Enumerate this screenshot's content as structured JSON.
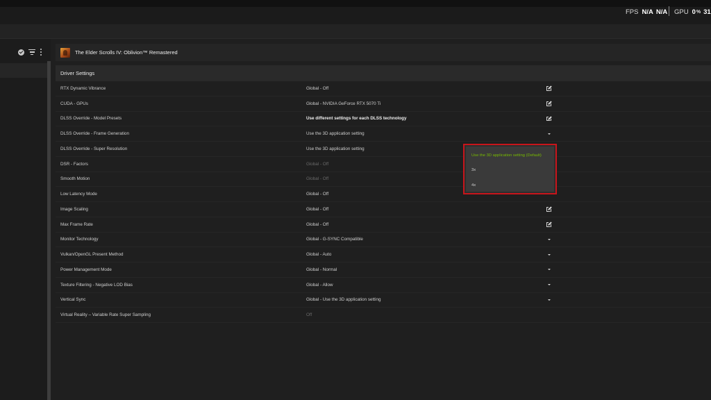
{
  "overlay": {
    "fps_label": "FPS",
    "fps_value1": "N/A",
    "fps_value2": "N/A",
    "gpu_label": "GPU",
    "gpu_value": "0",
    "gpu_unit": "%",
    "gpu_partial": "31"
  },
  "sidebar": {
    "icons": [
      "check-circle-icon",
      "filter-icon",
      "more-vertical-icon"
    ]
  },
  "game": {
    "title": "The Elder Scrolls IV: Oblivion™ Remastered"
  },
  "section": {
    "title": "Driver Settings"
  },
  "settings": [
    {
      "name": "RTX Dynamic Vibrance",
      "value": "Global - Off",
      "action": "edit"
    },
    {
      "name": "CUDA - GPUs",
      "value": "Global - NVIDIA GeForce RTX 5070 Ti",
      "action": "edit"
    },
    {
      "name": "DLSS Override - Model Presets",
      "value": "Use different settings for each DLSS technology",
      "action": "edit",
      "bold": true
    },
    {
      "name": "DLSS Override - Frame Generation",
      "value": "Use the 3D application setting",
      "action": "dropdown"
    },
    {
      "name": "DLSS Override - Super Resolution",
      "value": "Use the 3D application setting",
      "action": "none"
    },
    {
      "name": "DSR - Factors",
      "value": "Global - Off",
      "action": "none",
      "dim": true
    },
    {
      "name": "Smooth Motion",
      "value": "Global - Off",
      "action": "none",
      "dim": true
    },
    {
      "name": "Low Latency Mode",
      "value": "Global - Off",
      "action": "none"
    },
    {
      "name": "Image Scaling",
      "value": "Global - Off",
      "action": "edit"
    },
    {
      "name": "Max Frame Rate",
      "value": "Global - Off",
      "action": "edit"
    },
    {
      "name": "Monitor Technology",
      "value": "Global - G-SYNC Compatible",
      "action": "dropdown"
    },
    {
      "name": "Vulkan/OpenGL Present Method",
      "value": "Global - Auto",
      "action": "dropdown"
    },
    {
      "name": "Power Management Mode",
      "value": "Global - Normal",
      "action": "dropdown"
    },
    {
      "name": "Texture Filtering - Negative LOD Bias",
      "value": "Global - Allow",
      "action": "dropdown"
    },
    {
      "name": "Vertical Sync",
      "value": "Global - Use the 3D application setting",
      "action": "dropdown"
    },
    {
      "name": "Virtual Reality – Variable Rate Super Sampling",
      "value": "Off",
      "action": "none",
      "dim": true
    }
  ],
  "dropdown": {
    "options": [
      {
        "label": "Use the 3D application setting (Default)",
        "selected": true
      },
      {
        "label": "3x",
        "selected": false
      },
      {
        "label": "4x",
        "selected": false
      }
    ]
  },
  "colors": {
    "accent_green": "#76b900",
    "highlight_red": "#c8151b"
  }
}
